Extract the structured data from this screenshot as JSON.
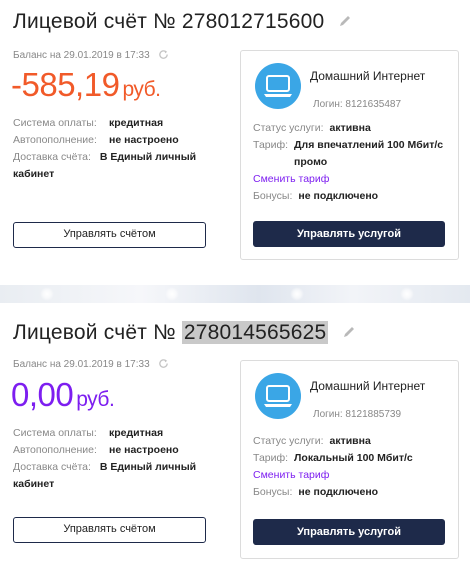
{
  "colors": {
    "negative_balance": "#f15a29",
    "zero_balance": "#7d1ef0",
    "link": "#7d1ef0",
    "primary_button": "#1e2a4a",
    "service_icon": "#3aa6e6"
  },
  "accounts": [
    {
      "title_prefix": "Лицевой счёт №",
      "number": "278012715600",
      "balance_caption": "Баланс на 29.01.2019 в 17:33",
      "amount": "-585,19",
      "unit": "руб.",
      "details": [
        {
          "label": "Система оплаты:",
          "value": "кредитная"
        },
        {
          "label": "Автопополнение:",
          "value": "не настроено"
        },
        {
          "label": "Доставка счёта:",
          "value": "В Единый личный кабинет"
        }
      ],
      "manage_button": "Управлять счётом",
      "service": {
        "name": "Домашний Интернет",
        "login": "Логин: 8121635487",
        "rows": [
          {
            "label": "Статус услуги:",
            "value": "активна"
          },
          {
            "label": "Тариф:",
            "value": "Для впечатлений 100 Мбит/с промо"
          }
        ],
        "change_tariff": "Сменить тариф",
        "bonus": {
          "label": "Бонусы:",
          "value": "не подключено"
        },
        "manage_button": "Управлять услугой"
      }
    },
    {
      "title_prefix": "Лицевой счёт №",
      "number": "278014565625",
      "balance_caption": "Баланс на 29.01.2019 в 17:33",
      "amount": "0,00",
      "unit": "руб.",
      "details": [
        {
          "label": "Система оплаты:",
          "value": "кредитная"
        },
        {
          "label": "Автопополнение:",
          "value": "не настроено"
        },
        {
          "label": "Доставка счёта:",
          "value": "В Единый личный кабинет"
        }
      ],
      "manage_button": "Управлять счётом",
      "service": {
        "name": "Домашний Интернет",
        "login": "Логин: 8121885739",
        "rows": [
          {
            "label": "Статус услуги:",
            "value": "активна"
          },
          {
            "label": "Тариф:",
            "value": "Локальный 100 Мбит/с"
          }
        ],
        "change_tariff": "Сменить тариф",
        "bonus": {
          "label": "Бонусы:",
          "value": "не подключено"
        },
        "manage_button": "Управлять услугой"
      }
    }
  ]
}
